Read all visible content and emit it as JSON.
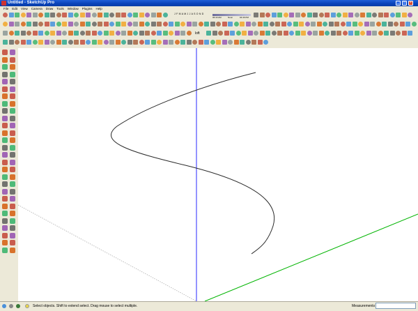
{
  "window": {
    "title": "Untitled - SketchUp Pro",
    "minimize_glyph": "_",
    "maximize_glyph": "□",
    "close_glyph": "×"
  },
  "menu": {
    "items": [
      "File",
      "Edit",
      "View",
      "Camera",
      "Draw",
      "Tools",
      "Window",
      "Plugins",
      "Help"
    ]
  },
  "toolbar": {
    "time_start": "06:43 AM",
    "time_noon": "Noon",
    "time_end": "04:46 PM",
    "months": "J F M A M J J A S O N D",
    "loft_label": "loft"
  },
  "statusbar": {
    "hint": "Select objects. Shift to extend select. Drag mouse to select multiple.",
    "measurements_label": "Measurements",
    "measurements_value": ""
  },
  "colors": {
    "blue_axis": "#2a2aff",
    "green_axis": "#00b400",
    "red_axis_dotted": "#b0b0b0",
    "curve": "#2a2a2a"
  },
  "icons": [
    "select-icon",
    "eraser-icon",
    "paint-icon",
    "line-icon",
    "rectangle-icon",
    "circle-icon",
    "arc-icon",
    "push-pull-icon",
    "move-icon",
    "rotate-icon",
    "scale-icon",
    "offset-icon",
    "tape-measure-icon",
    "protractor-icon",
    "text-icon",
    "axes-icon",
    "orbit-icon",
    "pan-icon",
    "zoom-icon",
    "zoom-window-icon",
    "zoom-extents-icon",
    "walk-icon",
    "look-around-icon",
    "section-plane-icon"
  ]
}
